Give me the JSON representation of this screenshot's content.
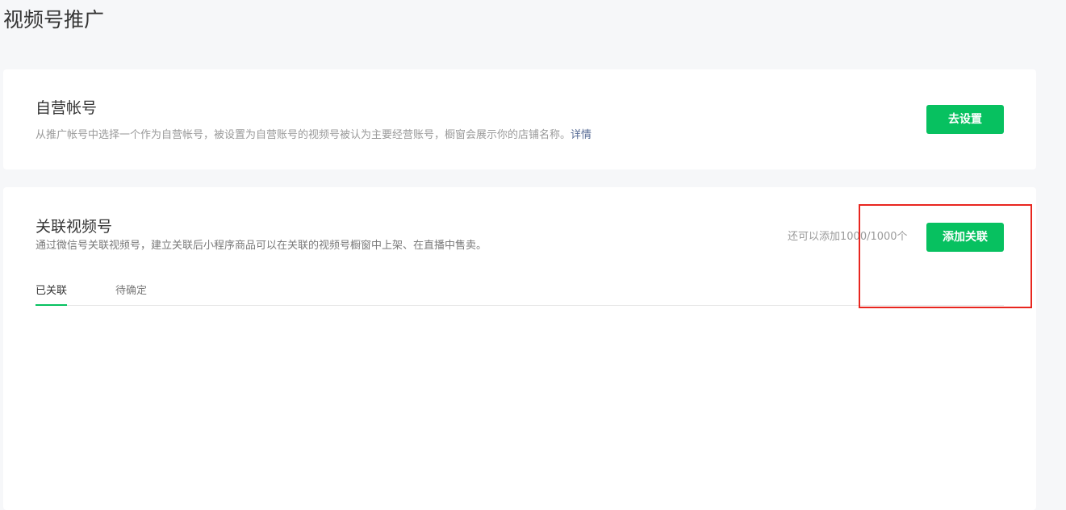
{
  "page": {
    "title": "视频号推广"
  },
  "own_account": {
    "title": "自营帐号",
    "description": "从推广帐号中选择一个作为自营帐号，被设置为自营账号的视频号被认为主要经营账号，橱窗会展示你的店铺名称。",
    "detail_link": "详情",
    "button_label": "去设置"
  },
  "linked_channels": {
    "title": "关联视频号",
    "description": "通过微信号关联视频号，建立关联后小程序商品可以在关联的视频号橱窗中上架、在直播中售卖。",
    "quota_text": "还可以添加1000/1000个",
    "button_label": "添加关联",
    "tabs": [
      {
        "label": "已关联",
        "active": true
      },
      {
        "label": "待确定",
        "active": false
      }
    ]
  },
  "colors": {
    "accent": "#07c160",
    "link": "#576b95",
    "highlight": "#e8261f",
    "background": "#f6f7f9"
  }
}
